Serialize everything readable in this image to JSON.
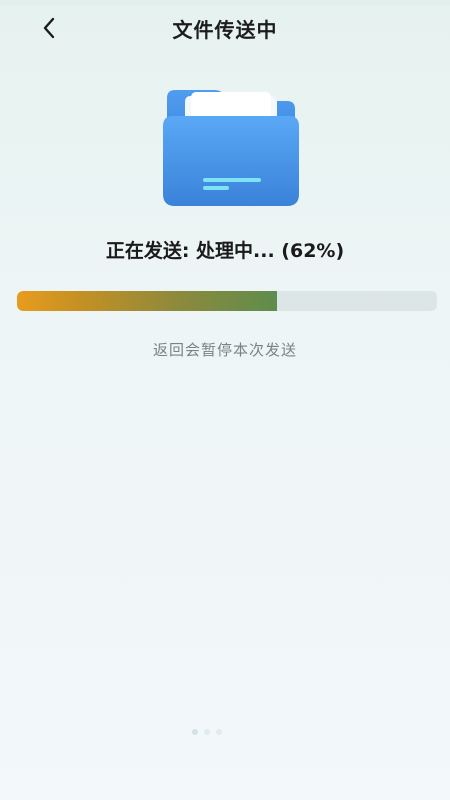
{
  "header": {
    "title": "文件传送中",
    "back_icon": "chevron-left-icon"
  },
  "transfer": {
    "folder_icon": "folder-icon",
    "status_text": "正在发送: 处理中... (62%)",
    "progress_fraction": 0.62,
    "hint": "返回会暂停本次发送"
  },
  "pager": {
    "count": 3,
    "active": 0
  },
  "colors": {
    "folder_blue": "#3f8fe0",
    "progress_start": "#e89c1e",
    "progress_end": "#5f8c4d",
    "track": "#dde6e6"
  }
}
